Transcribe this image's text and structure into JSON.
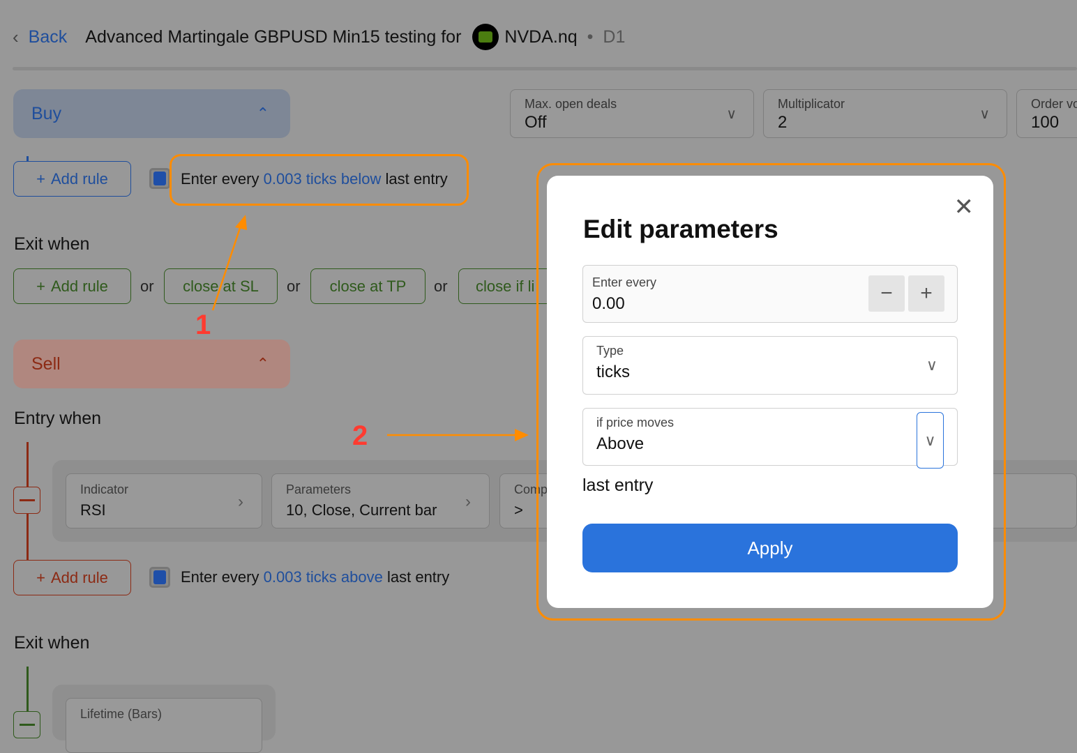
{
  "header": {
    "back": "Back",
    "title": "Advanced Martingale GBPUSD Min15 testing for",
    "symbol": "NVDA.nq",
    "timeframe": "D1"
  },
  "buy": {
    "label": "Buy",
    "add_rule": "Add rule",
    "rule": {
      "prefix": "Enter every",
      "highlight": "0.003 ticks below",
      "suffix": "last entry"
    },
    "exit_when": "Exit when",
    "exit_add_rule": "Add rule",
    "or": "or",
    "exit_buttons": [
      "close at SL",
      "close at TP",
      "close if li"
    ]
  },
  "settings": [
    {
      "label": "Max. open deals",
      "value": "Off"
    },
    {
      "label": "Multiplicator",
      "value": "2"
    },
    {
      "label": "Order vo",
      "value": "100"
    }
  ],
  "sell": {
    "label": "Sell",
    "entry_when": "Entry when",
    "cards": [
      {
        "label": "Indicator",
        "value": "RSI"
      },
      {
        "label": "Parameters",
        "value": "10, Close, Current bar"
      },
      {
        "label": "Comp",
        "value": ">"
      }
    ],
    "add_rule": "Add rule",
    "rule": {
      "prefix": "Enter every",
      "highlight": "0.003 ticks above",
      "suffix": "last entry"
    },
    "exit_when": "Exit when",
    "exit_card": {
      "label": "Lifetime (Bars)"
    }
  },
  "modal": {
    "title": "Edit parameters",
    "enter_every": {
      "label": "Enter every",
      "value": "0.00"
    },
    "type": {
      "label": "Type",
      "value": "ticks"
    },
    "price_moves": {
      "label": "if price moves",
      "value": "Above"
    },
    "suffix": "last entry",
    "apply": "Apply"
  },
  "annotations": {
    "one": "1",
    "two": "2"
  },
  "colors": {
    "accent": "#2a73dc",
    "highlight": "#ff8c00",
    "annotation": "#ff3b30"
  }
}
